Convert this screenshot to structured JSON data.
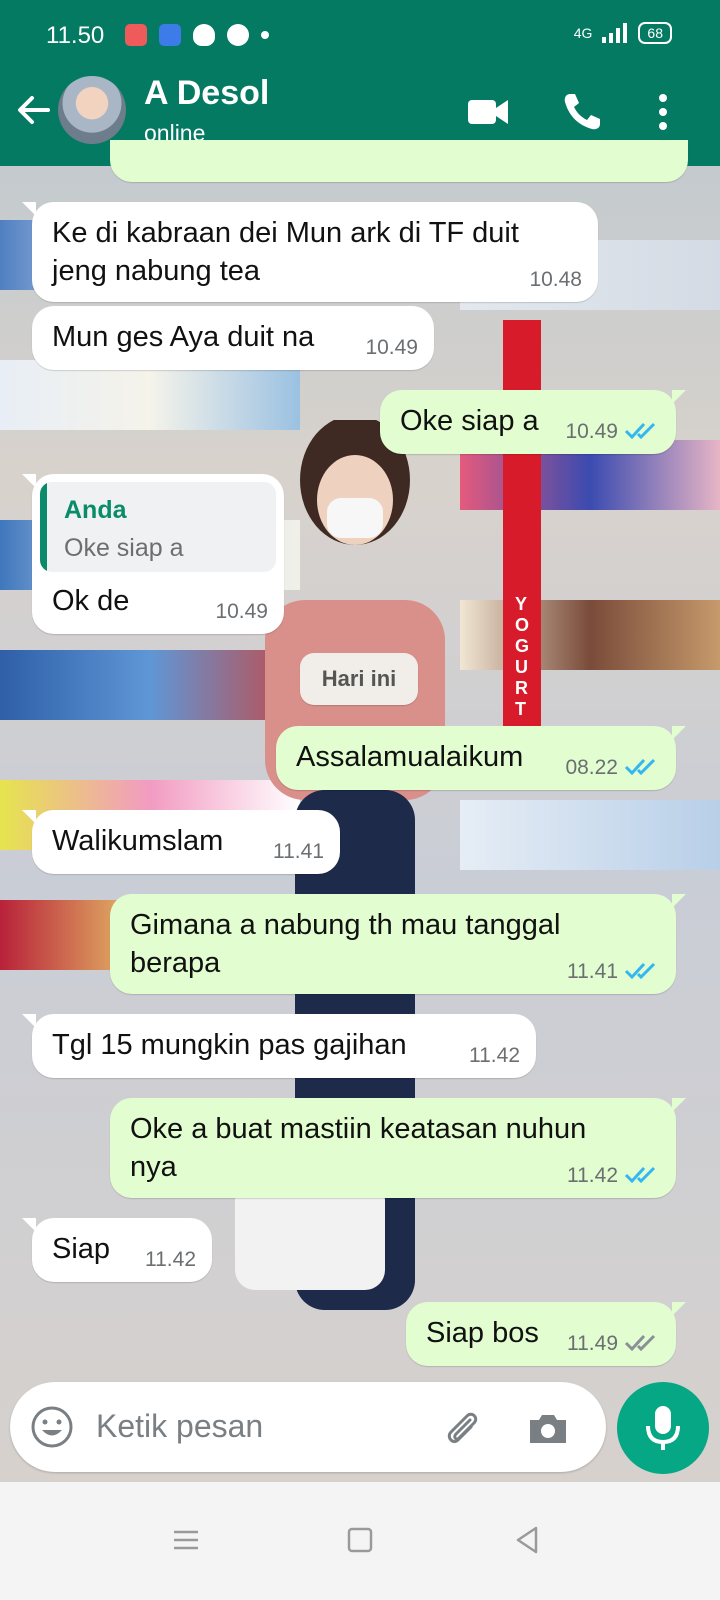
{
  "status_bar": {
    "time": "11.50",
    "network": "4G",
    "battery": "68"
  },
  "header": {
    "contact_name": "A Desol",
    "presence": "online"
  },
  "messages": [
    {
      "dir": "in",
      "text": "Ke di kabraan dei Mun ark di TF duit jeng nabung tea",
      "time": "10.48"
    },
    {
      "dir": "in",
      "text": "Mun ges Aya duit na",
      "time": "10.49"
    },
    {
      "dir": "out",
      "text": "Oke siap a",
      "time": "10.49",
      "status": "read"
    },
    {
      "dir": "in",
      "quote_author": "Anda",
      "quote_text": "Oke siap a",
      "text": "Ok de",
      "time": "10.49"
    },
    {
      "dir": "out",
      "text": "Assalamualaikum",
      "time": "08.22",
      "status": "read"
    },
    {
      "dir": "in",
      "text": "Walikumslam",
      "time": "11.41"
    },
    {
      "dir": "out",
      "text": "Gimana a nabung th mau tanggal berapa",
      "time": "11.41",
      "status": "read"
    },
    {
      "dir": "in",
      "text": "Tgl 15 mungkin pas gajihan",
      "time": "11.42"
    },
    {
      "dir": "out",
      "text": "Oke a buat mastiin keatasan nuhun nya",
      "time": "11.42",
      "status": "read"
    },
    {
      "dir": "in",
      "text": "Siap",
      "time": "11.42"
    },
    {
      "dir": "out",
      "text": "Siap bos",
      "time": "11.49",
      "status": "delivered"
    }
  ],
  "date_divider": "Hari ini",
  "background_sign": "YOGURT",
  "composer": {
    "placeholder": "Ketik pesan"
  },
  "colors": {
    "header": "#057a62",
    "outgoing": "#e2fdd0",
    "incoming": "#ffffff",
    "read_ticks": "#34b7f1",
    "mic": "#05a784"
  }
}
